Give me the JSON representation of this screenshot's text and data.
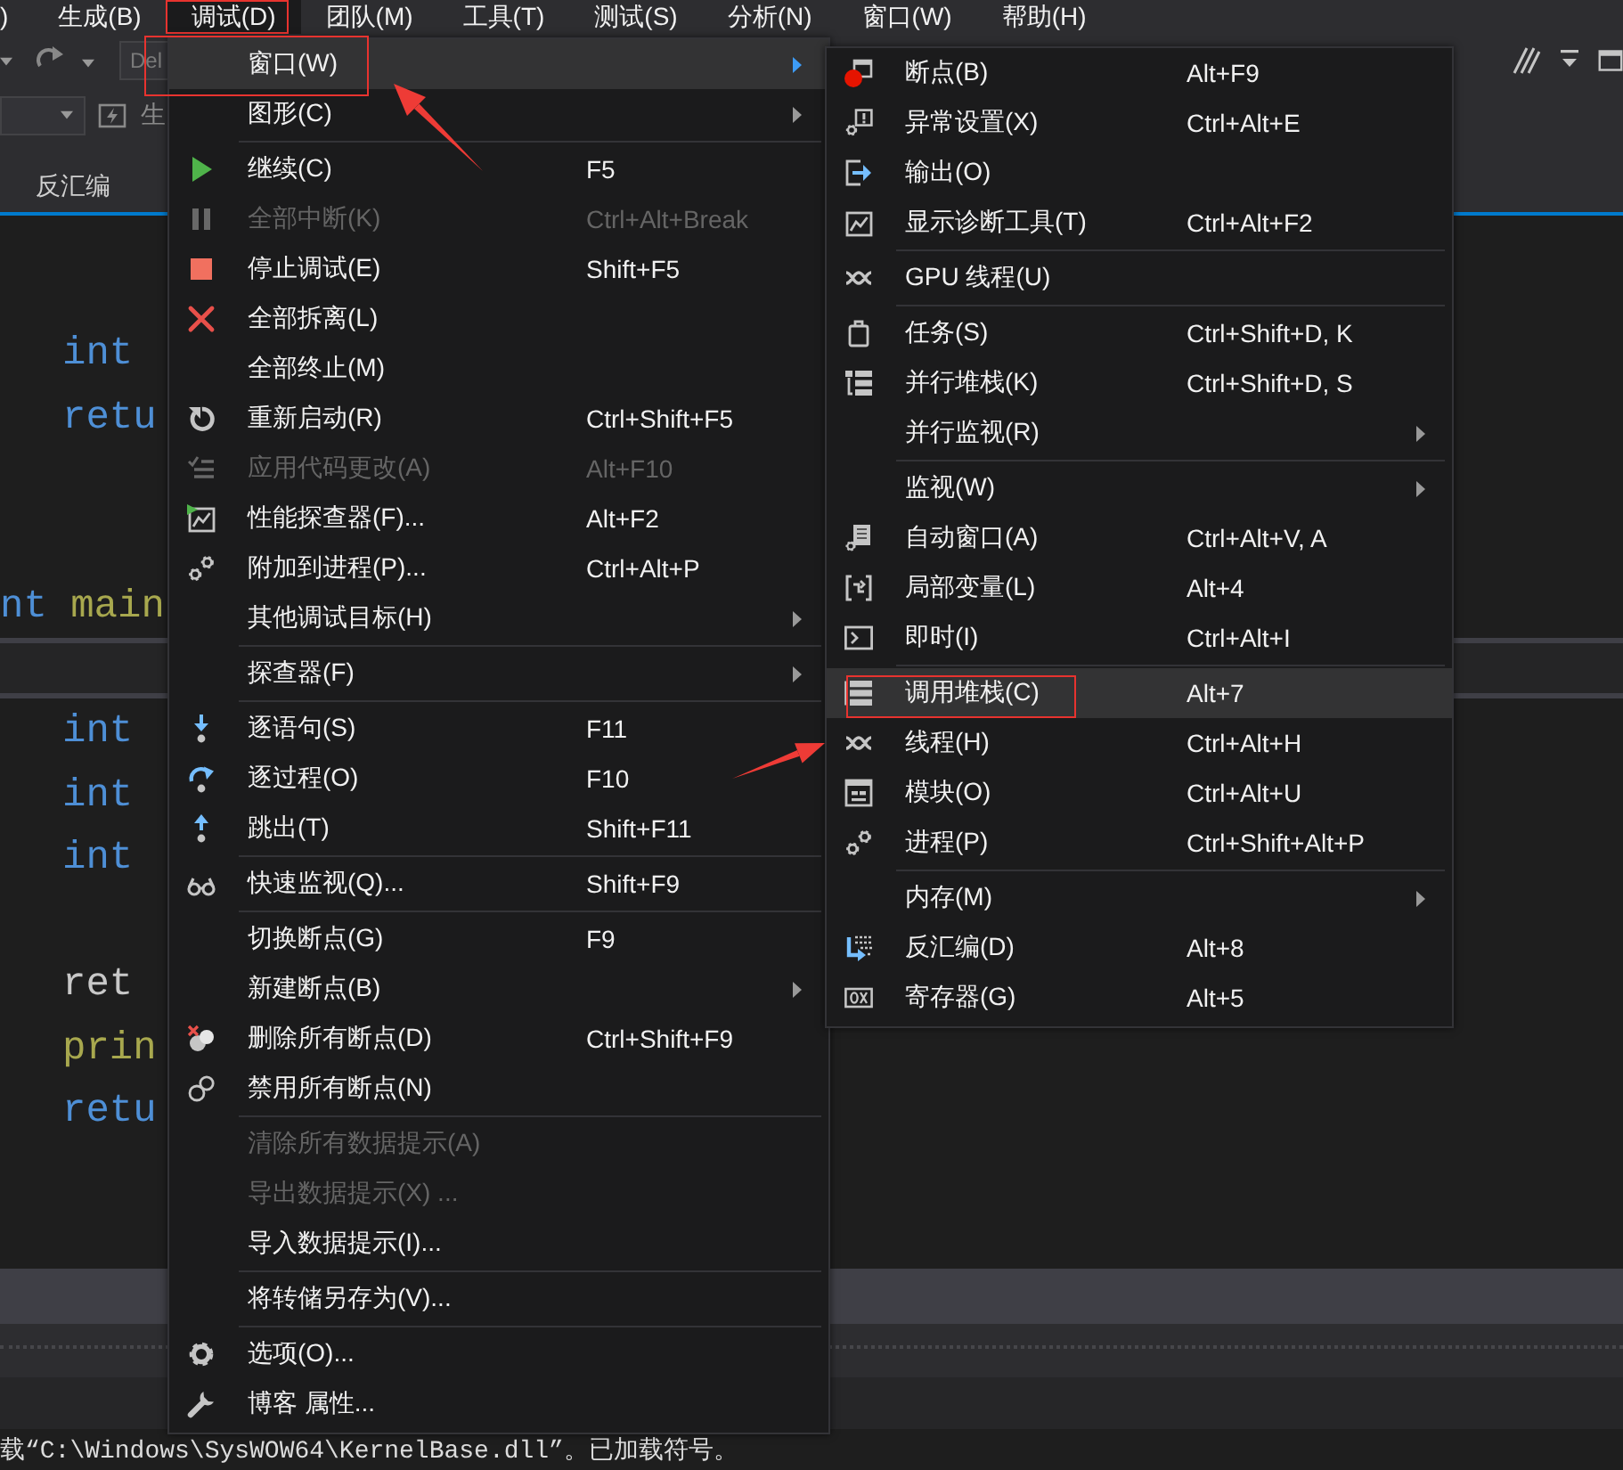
{
  "menubar": {
    "items": [
      {
        "label": ")",
        "selected": false,
        "annotated": false
      },
      {
        "label": "生成(B)",
        "selected": false,
        "annotated": false
      },
      {
        "label": "调试(D)",
        "selected": true,
        "annotated": true
      },
      {
        "label": "团队(M)",
        "selected": false,
        "annotated": false
      },
      {
        "label": "工具(T)",
        "selected": false,
        "annotated": false
      },
      {
        "label": "测试(S)",
        "selected": false,
        "annotated": false
      },
      {
        "label": "分析(N)",
        "selected": false,
        "annotated": false
      },
      {
        "label": "窗口(W)",
        "selected": false,
        "annotated": false
      },
      {
        "label": "帮助(H)",
        "selected": false,
        "annotated": false
      }
    ]
  },
  "toolbar": {
    "configuration_dropdown": {
      "value": "Del"
    },
    "toolbar_button": {
      "label": "生"
    }
  },
  "document_tabs": [
    {
      "label": "反汇编"
    }
  ],
  "editor_panes": [
    {
      "lines": [
        {
          "kind": "code",
          "indented": true,
          "tokens": [
            {
              "text": "int",
              "kind": "keyword"
            }
          ]
        },
        {
          "kind": "code",
          "indented": true,
          "tokens": [
            {
              "text": "retu",
              "kind": "keyword"
            }
          ]
        },
        {
          "kind": "blank"
        },
        {
          "kind": "blank"
        },
        {
          "kind": "code",
          "indented": false,
          "tokens": [
            {
              "text": "nt",
              "kind": "keyword"
            },
            {
              "text": "main",
              "kind": "function"
            }
          ]
        }
      ]
    },
    {
      "lines": [
        {
          "kind": "code",
          "indented": true,
          "tokens": [
            {
              "text": "int",
              "kind": "keyword"
            }
          ]
        },
        {
          "kind": "code",
          "indented": true,
          "tokens": [
            {
              "text": "int",
              "kind": "keyword"
            }
          ]
        },
        {
          "kind": "code",
          "indented": true,
          "tokens": [
            {
              "text": "int",
              "kind": "keyword"
            }
          ]
        },
        {
          "kind": "blank"
        },
        {
          "kind": "code",
          "indented": true,
          "tokens": [
            {
              "text": "ret",
              "kind": "plain"
            }
          ]
        },
        {
          "kind": "code",
          "indented": true,
          "tokens": [
            {
              "text": "prin",
              "kind": "function"
            }
          ]
        },
        {
          "kind": "code",
          "indented": true,
          "tokens": [
            {
              "text": "retu",
              "kind": "keyword"
            }
          ]
        }
      ]
    }
  ],
  "output": {
    "lines": [
      "载“C:\\Windows\\SysWOW64\\KernelBase.dll”。已加载符号。"
    ]
  },
  "debug_menu": {
    "sections": [
      {
        "items": [
          {
            "label": "窗口(W)",
            "disabled": false,
            "selected": true,
            "submenu": true,
            "annotated": true
          },
          {
            "label": "图形(C)",
            "disabled": false,
            "selected": false,
            "submenu": true,
            "annotated": false
          }
        ]
      },
      {
        "items": [
          {
            "label": "继续(C)",
            "shortcut": "F5",
            "disabled": false,
            "selected": false,
            "submenu": false,
            "annotated": false
          },
          {
            "label": "全部中断(K)",
            "shortcut": "Ctrl+Alt+Break",
            "disabled": true,
            "selected": false,
            "submenu": false,
            "annotated": false
          },
          {
            "label": "停止调试(E)",
            "shortcut": "Shift+F5",
            "disabled": false,
            "selected": false,
            "submenu": false,
            "annotated": false
          },
          {
            "label": "全部拆离(L)",
            "disabled": false,
            "selected": false,
            "submenu": false,
            "annotated": false
          },
          {
            "label": "全部终止(M)",
            "disabled": false,
            "selected": false,
            "submenu": false,
            "annotated": false
          },
          {
            "label": "重新启动(R)",
            "shortcut": "Ctrl+Shift+F5",
            "disabled": false,
            "selected": false,
            "submenu": false,
            "annotated": false
          },
          {
            "label": "应用代码更改(A)",
            "shortcut": "Alt+F10",
            "disabled": true,
            "selected": false,
            "submenu": false,
            "annotated": false
          },
          {
            "label": "性能探查器(F)...",
            "shortcut": "Alt+F2",
            "disabled": false,
            "selected": false,
            "submenu": false,
            "annotated": false
          },
          {
            "label": "附加到进程(P)...",
            "shortcut": "Ctrl+Alt+P",
            "disabled": false,
            "selected": false,
            "submenu": false,
            "annotated": false
          },
          {
            "label": "其他调试目标(H)",
            "disabled": false,
            "selected": false,
            "submenu": true,
            "annotated": false
          }
        ]
      },
      {
        "items": [
          {
            "label": "探查器(F)",
            "disabled": false,
            "selected": false,
            "submenu": true,
            "annotated": false
          }
        ]
      },
      {
        "items": [
          {
            "label": "逐语句(S)",
            "shortcut": "F11",
            "disabled": false,
            "selected": false,
            "submenu": false,
            "annotated": false
          },
          {
            "label": "逐过程(O)",
            "shortcut": "F10",
            "disabled": false,
            "selected": false,
            "submenu": false,
            "annotated": false
          },
          {
            "label": "跳出(T)",
            "shortcut": "Shift+F11",
            "disabled": false,
            "selected": false,
            "submenu": false,
            "annotated": false
          }
        ]
      },
      {
        "items": [
          {
            "label": "快速监视(Q)...",
            "shortcut": "Shift+F9",
            "disabled": false,
            "selected": false,
            "submenu": false,
            "annotated": false
          }
        ]
      },
      {
        "items": [
          {
            "label": "切换断点(G)",
            "shortcut": "F9",
            "disabled": false,
            "selected": false,
            "submenu": false,
            "annotated": false
          },
          {
            "label": "新建断点(B)",
            "disabled": false,
            "selected": false,
            "submenu": true,
            "annotated": false
          },
          {
            "label": "删除所有断点(D)",
            "shortcut": "Ctrl+Shift+F9",
            "disabled": false,
            "selected": false,
            "submenu": false,
            "annotated": false
          },
          {
            "label": "禁用所有断点(N)",
            "disabled": false,
            "selected": false,
            "submenu": false,
            "annotated": false
          }
        ]
      },
      {
        "items": [
          {
            "label": "清除所有数据提示(A)",
            "disabled": true,
            "selected": false,
            "submenu": false,
            "annotated": false
          },
          {
            "label": "导出数据提示(X) ...",
            "disabled": true,
            "selected": false,
            "submenu": false,
            "annotated": false
          },
          {
            "label": "导入数据提示(I)...",
            "disabled": false,
            "selected": false,
            "submenu": false,
            "annotated": false
          }
        ]
      },
      {
        "items": [
          {
            "label": "将转储另存为(V)...",
            "disabled": false,
            "selected": false,
            "submenu": false,
            "annotated": false
          }
        ]
      },
      {
        "items": [
          {
            "label": "选项(O)...",
            "disabled": false,
            "selected": false,
            "submenu": false,
            "annotated": false
          },
          {
            "label": "博客 属性...",
            "disabled": false,
            "selected": false,
            "submenu": false,
            "annotated": false
          }
        ]
      }
    ]
  },
  "window_submenu": {
    "sections": [
      {
        "items": [
          {
            "label": "断点(B)",
            "shortcut": "Alt+F9",
            "disabled": false,
            "selected": false,
            "submenu": false,
            "annotated": false
          },
          {
            "label": "异常设置(X)",
            "shortcut": "Ctrl+Alt+E",
            "disabled": false,
            "selected": false,
            "submenu": false,
            "annotated": false
          },
          {
            "label": "输出(O)",
            "disabled": false,
            "selected": false,
            "submenu": false,
            "annotated": false
          },
          {
            "label": "显示诊断工具(T)",
            "shortcut": "Ctrl+Alt+F2",
            "disabled": false,
            "selected": false,
            "submenu": false,
            "annotated": false
          }
        ]
      },
      {
        "items": [
          {
            "label": "GPU 线程(U)",
            "disabled": false,
            "selected": false,
            "submenu": false,
            "annotated": false
          }
        ]
      },
      {
        "items": [
          {
            "label": "任务(S)",
            "shortcut": "Ctrl+Shift+D, K",
            "disabled": false,
            "selected": false,
            "submenu": false,
            "annotated": false
          },
          {
            "label": "并行堆栈(K)",
            "shortcut": "Ctrl+Shift+D, S",
            "disabled": false,
            "selected": false,
            "submenu": false,
            "annotated": false
          },
          {
            "label": "并行监视(R)",
            "disabled": false,
            "selected": false,
            "submenu": true,
            "annotated": false
          }
        ]
      },
      {
        "items": [
          {
            "label": "监视(W)",
            "disabled": false,
            "selected": false,
            "submenu": true,
            "annotated": false
          },
          {
            "label": "自动窗口(A)",
            "shortcut": "Ctrl+Alt+V, A",
            "disabled": false,
            "selected": false,
            "submenu": false,
            "annotated": false
          },
          {
            "label": "局部变量(L)",
            "shortcut": "Alt+4",
            "disabled": false,
            "selected": false,
            "submenu": false,
            "annotated": false
          },
          {
            "label": "即时(I)",
            "shortcut": "Ctrl+Alt+I",
            "disabled": false,
            "selected": false,
            "submenu": false,
            "annotated": false
          }
        ]
      },
      {
        "items": [
          {
            "label": "调用堆栈(C)",
            "shortcut": "Alt+7",
            "disabled": false,
            "selected": true,
            "submenu": false,
            "annotated": true
          },
          {
            "label": "线程(H)",
            "shortcut": "Ctrl+Alt+H",
            "disabled": false,
            "selected": false,
            "submenu": false,
            "annotated": false
          },
          {
            "label": "模块(O)",
            "shortcut": "Ctrl+Alt+U",
            "disabled": false,
            "selected": false,
            "submenu": false,
            "annotated": false
          },
          {
            "label": "进程(P)",
            "shortcut": "Ctrl+Shift+Alt+P",
            "disabled": false,
            "selected": false,
            "submenu": false,
            "annotated": false
          }
        ]
      },
      {
        "items": [
          {
            "label": "内存(M)",
            "disabled": false,
            "selected": false,
            "submenu": true,
            "annotated": false
          },
          {
            "label": "反汇编(D)",
            "shortcut": "Alt+8",
            "disabled": false,
            "selected": false,
            "submenu": false,
            "annotated": false
          },
          {
            "label": "寄存器(G)",
            "shortcut": "Alt+5",
            "disabled": false,
            "selected": false,
            "submenu": false,
            "annotated": false
          }
        ]
      }
    ]
  }
}
